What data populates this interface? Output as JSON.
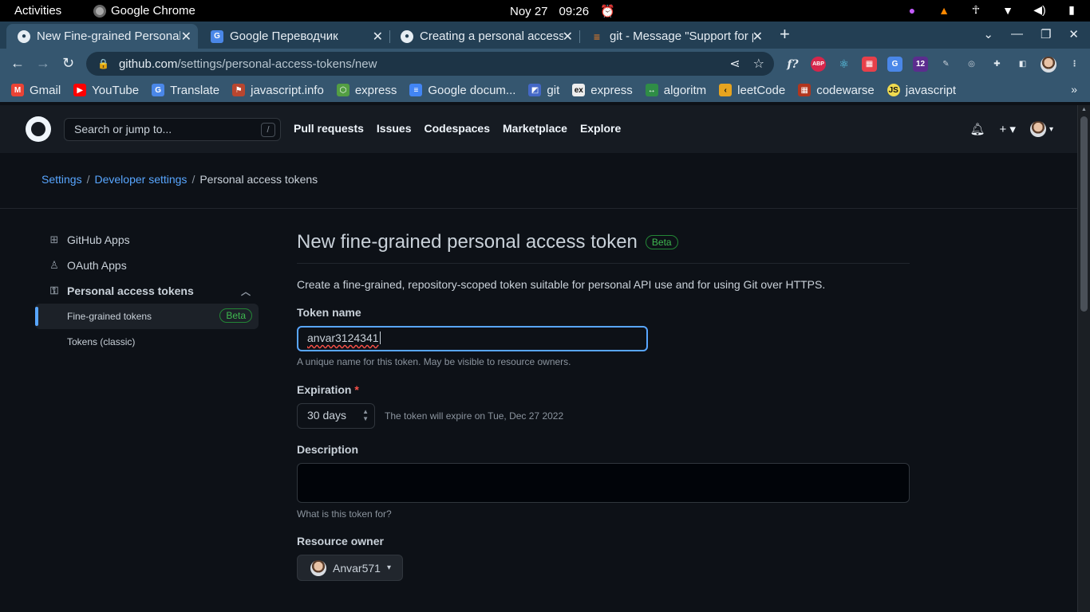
{
  "os_bar": {
    "activities": "Activities",
    "app_name": "Google Chrome",
    "date": "Noy 27",
    "time": "09:26"
  },
  "tabs": [
    {
      "title": "New Fine-grained Personal access token",
      "favicon": "github-icon",
      "active": true
    },
    {
      "title": "Google Переводчик",
      "favicon": "translate-icon",
      "active": false
    },
    {
      "title": "Creating a personal access token",
      "favicon": "github-icon",
      "active": false
    },
    {
      "title": "git - Message \"Support for password authentication\"",
      "favicon": "stackoverflow-icon",
      "active": false
    }
  ],
  "omnibox": {
    "host": "github.com",
    "path": "/settings/personal-access-tokens/new"
  },
  "bookmarks": [
    {
      "label": "Gmail",
      "icon": "gmail-icon",
      "color": "#ea4335"
    },
    {
      "label": "YouTube",
      "icon": "youtube-icon",
      "color": "#ff0000"
    },
    {
      "label": "Translate",
      "icon": "translate-icon",
      "color": "#4a87e8"
    },
    {
      "label": "javascript.info",
      "icon": "js-info-icon",
      "color": "#b8462f"
    },
    {
      "label": "express",
      "icon": "node-icon",
      "color": "#539e43"
    },
    {
      "label": "Google docum...",
      "icon": "docs-icon",
      "color": "#4285f4"
    },
    {
      "label": "git",
      "icon": "git-icon",
      "color": "#4468c7"
    },
    {
      "label": "express",
      "icon": "ex-icon",
      "color": "#eeeeee"
    },
    {
      "label": "algoritm",
      "icon": "algoritm-icon",
      "color": "#2f8d46"
    },
    {
      "label": "leetCode",
      "icon": "leetcode-icon",
      "color": "#e7a41f"
    },
    {
      "label": "codewarse",
      "icon": "codewars-icon",
      "color": "#b1361e"
    },
    {
      "label": "javascript",
      "icon": "javascript-icon",
      "color": "#f0db4f"
    }
  ],
  "github": {
    "search_placeholder": "Search or jump to...",
    "search_key": "/",
    "nav": [
      "Pull requests",
      "Issues",
      "Codespaces",
      "Marketplace",
      "Explore"
    ]
  },
  "breadcrumb": {
    "settings": "Settings",
    "developer": "Developer settings",
    "current": "Personal access tokens",
    "sep": "/"
  },
  "sidebar": {
    "items": [
      {
        "label": "GitHub Apps",
        "icon": "apps-icon"
      },
      {
        "label": "OAuth Apps",
        "icon": "person-icon"
      },
      {
        "label": "Personal access tokens",
        "icon": "key-icon"
      }
    ],
    "sub": [
      {
        "label": "Fine-grained tokens",
        "badge": "Beta"
      },
      {
        "label": "Tokens (classic)"
      }
    ]
  },
  "form": {
    "title": "New fine-grained personal access token",
    "title_badge": "Beta",
    "lead": "Create a fine-grained, repository-scoped token suitable for personal API use and for using Git over HTTPS.",
    "token_name_label": "Token name",
    "token_name_value": "anvar3124341",
    "token_name_note": "A unique name for this token. May be visible to resource owners.",
    "expiration_label": "Expiration",
    "required_mark": "*",
    "expiration_value": "30 days",
    "expiration_note": "The token will expire on Tue, Dec 27 2022",
    "description_label": "Description",
    "description_note": "What is this token for?",
    "owner_label": "Resource owner",
    "owner_value": "Anvar571"
  }
}
